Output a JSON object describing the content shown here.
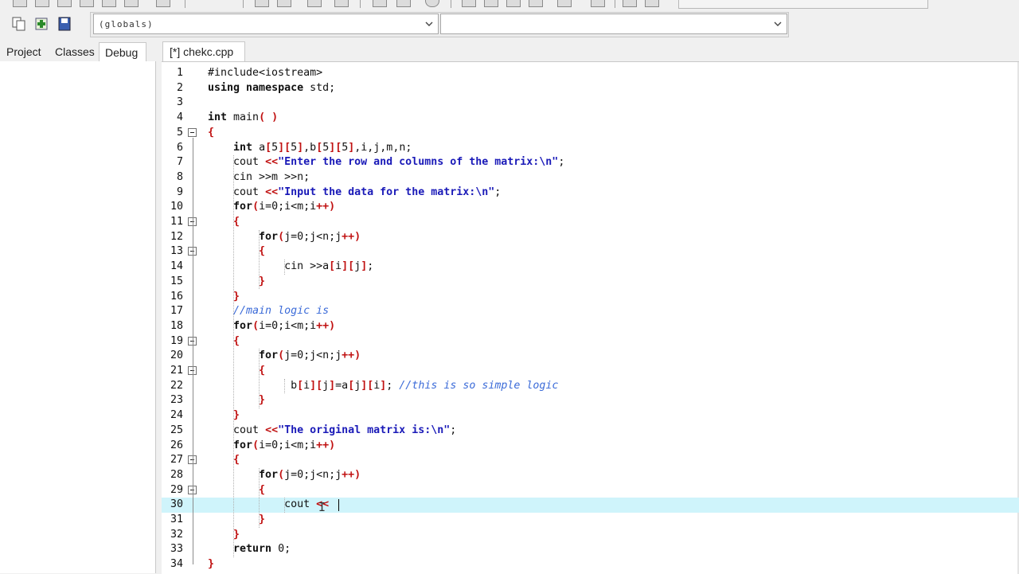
{
  "toolbar": {
    "scope_combo": {
      "value": "(globals)"
    },
    "symbol_combo": {
      "value": ""
    }
  },
  "side_panel": {
    "tabs": [
      {
        "label": "Project"
      },
      {
        "label": "Classes"
      },
      {
        "label": "Debug"
      }
    ],
    "active_tab": "Debug"
  },
  "editor": {
    "tab_label": "[*] chekc.cpp",
    "current_line": 30,
    "lines": [
      {
        "n": "1",
        "text": "#include<iostream>"
      },
      {
        "n": "2",
        "text": "using namespace std;"
      },
      {
        "n": "3",
        "text": ""
      },
      {
        "n": "4",
        "text": "int main( )"
      },
      {
        "n": "5",
        "text": "{"
      },
      {
        "n": "6",
        "text": "    int a[5][5],b[5][5],i,j,m,n;"
      },
      {
        "n": "7",
        "text": "    cout <<\"Enter the row and columns of the matrix:\\n\";"
      },
      {
        "n": "8",
        "text": "    cin >>m >>n;"
      },
      {
        "n": "9",
        "text": "    cout <<\"Input the data for the matrix:\\n\";"
      },
      {
        "n": "10",
        "text": "    for(i=0;i<m;i++)"
      },
      {
        "n": "11",
        "text": "    {"
      },
      {
        "n": "12",
        "text": "        for(j=0;j<n;j++)"
      },
      {
        "n": "13",
        "text": "        {"
      },
      {
        "n": "14",
        "text": "            cin >>a[i][j];"
      },
      {
        "n": "15",
        "text": "        }"
      },
      {
        "n": "16",
        "text": "    }"
      },
      {
        "n": "17",
        "text": "    //main logic is"
      },
      {
        "n": "18",
        "text": "    for(i=0;i<m;i++)"
      },
      {
        "n": "19",
        "text": "    {"
      },
      {
        "n": "20",
        "text": "        for(j=0;j<n;j++)"
      },
      {
        "n": "21",
        "text": "        {"
      },
      {
        "n": "22",
        "text": "             b[i][j]=a[j][i]; //this is so simple logic"
      },
      {
        "n": "23",
        "text": "        }"
      },
      {
        "n": "24",
        "text": "    }"
      },
      {
        "n": "25",
        "text": "    cout <<\"The original matrix is:\\n\";"
      },
      {
        "n": "26",
        "text": "    for(i=0;i<m;i++)"
      },
      {
        "n": "27",
        "text": "    {"
      },
      {
        "n": "28",
        "text": "        for(j=0;j<n;j++)"
      },
      {
        "n": "29",
        "text": "        {"
      },
      {
        "n": "30",
        "text": "            cout <<"
      },
      {
        "n": "31",
        "text": "        }"
      },
      {
        "n": "32",
        "text": "    }"
      },
      {
        "n": "33",
        "text": "    return 0;"
      },
      {
        "n": "34",
        "text": "}"
      }
    ],
    "fold_markers": [
      "5",
      "11",
      "13",
      "19",
      "21",
      "27",
      "29"
    ]
  }
}
